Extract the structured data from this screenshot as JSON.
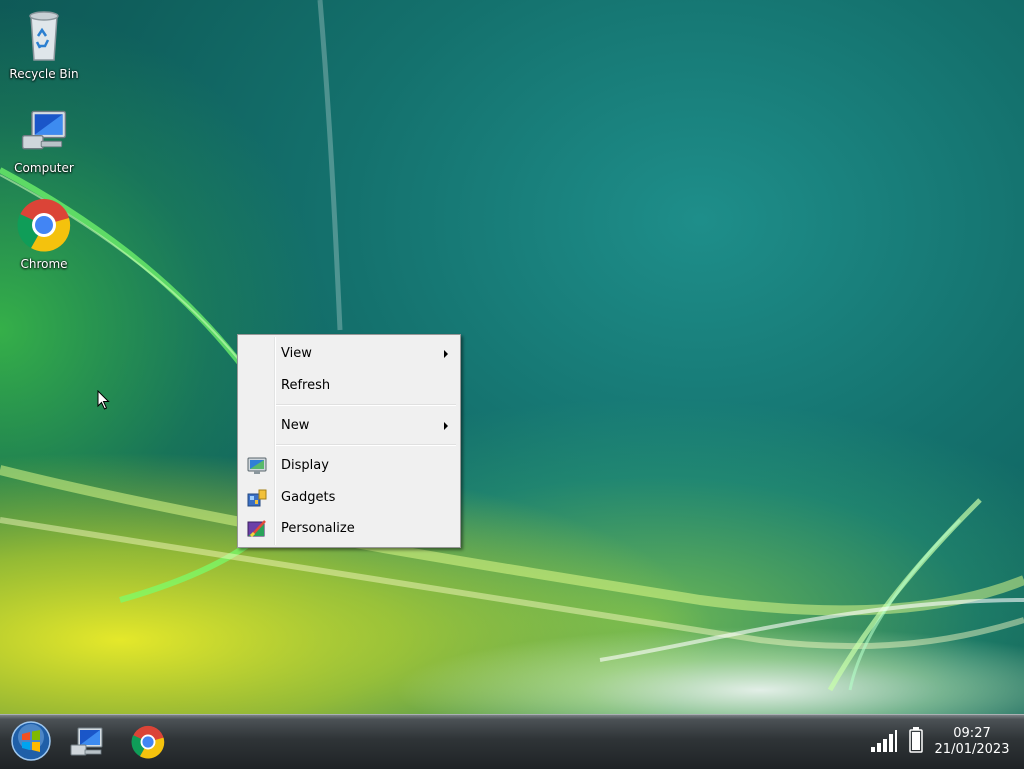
{
  "desktop": {
    "icons": [
      {
        "label": "Recycle Bin",
        "icon": "recycle-bin-icon"
      },
      {
        "label": "Computer",
        "icon": "computer-icon"
      },
      {
        "label": "Chrome",
        "icon": "chrome-icon"
      }
    ]
  },
  "context_menu": {
    "items": [
      {
        "label": "View",
        "has_submenu": true
      },
      {
        "label": "Refresh",
        "has_submenu": false
      },
      {
        "label": "New",
        "has_submenu": true
      },
      {
        "label": "Display",
        "icon": "display-icon"
      },
      {
        "label": "Gadgets",
        "icon": "gadgets-icon"
      },
      {
        "label": "Personalize",
        "icon": "personalize-icon"
      }
    ]
  },
  "taskbar": {
    "start_button": "start-orb-icon",
    "pinned": [
      "computer-icon",
      "chrome-icon"
    ],
    "tray": {
      "signal_icon": "signal-bars-icon",
      "battery_icon": "battery-icon",
      "time": "09:27",
      "date": "21/01/2023"
    }
  },
  "colors": {
    "wallpaper_teal": "#14716d",
    "menu_bg": "#f0f0f0",
    "taskbar": "#2f3437"
  }
}
